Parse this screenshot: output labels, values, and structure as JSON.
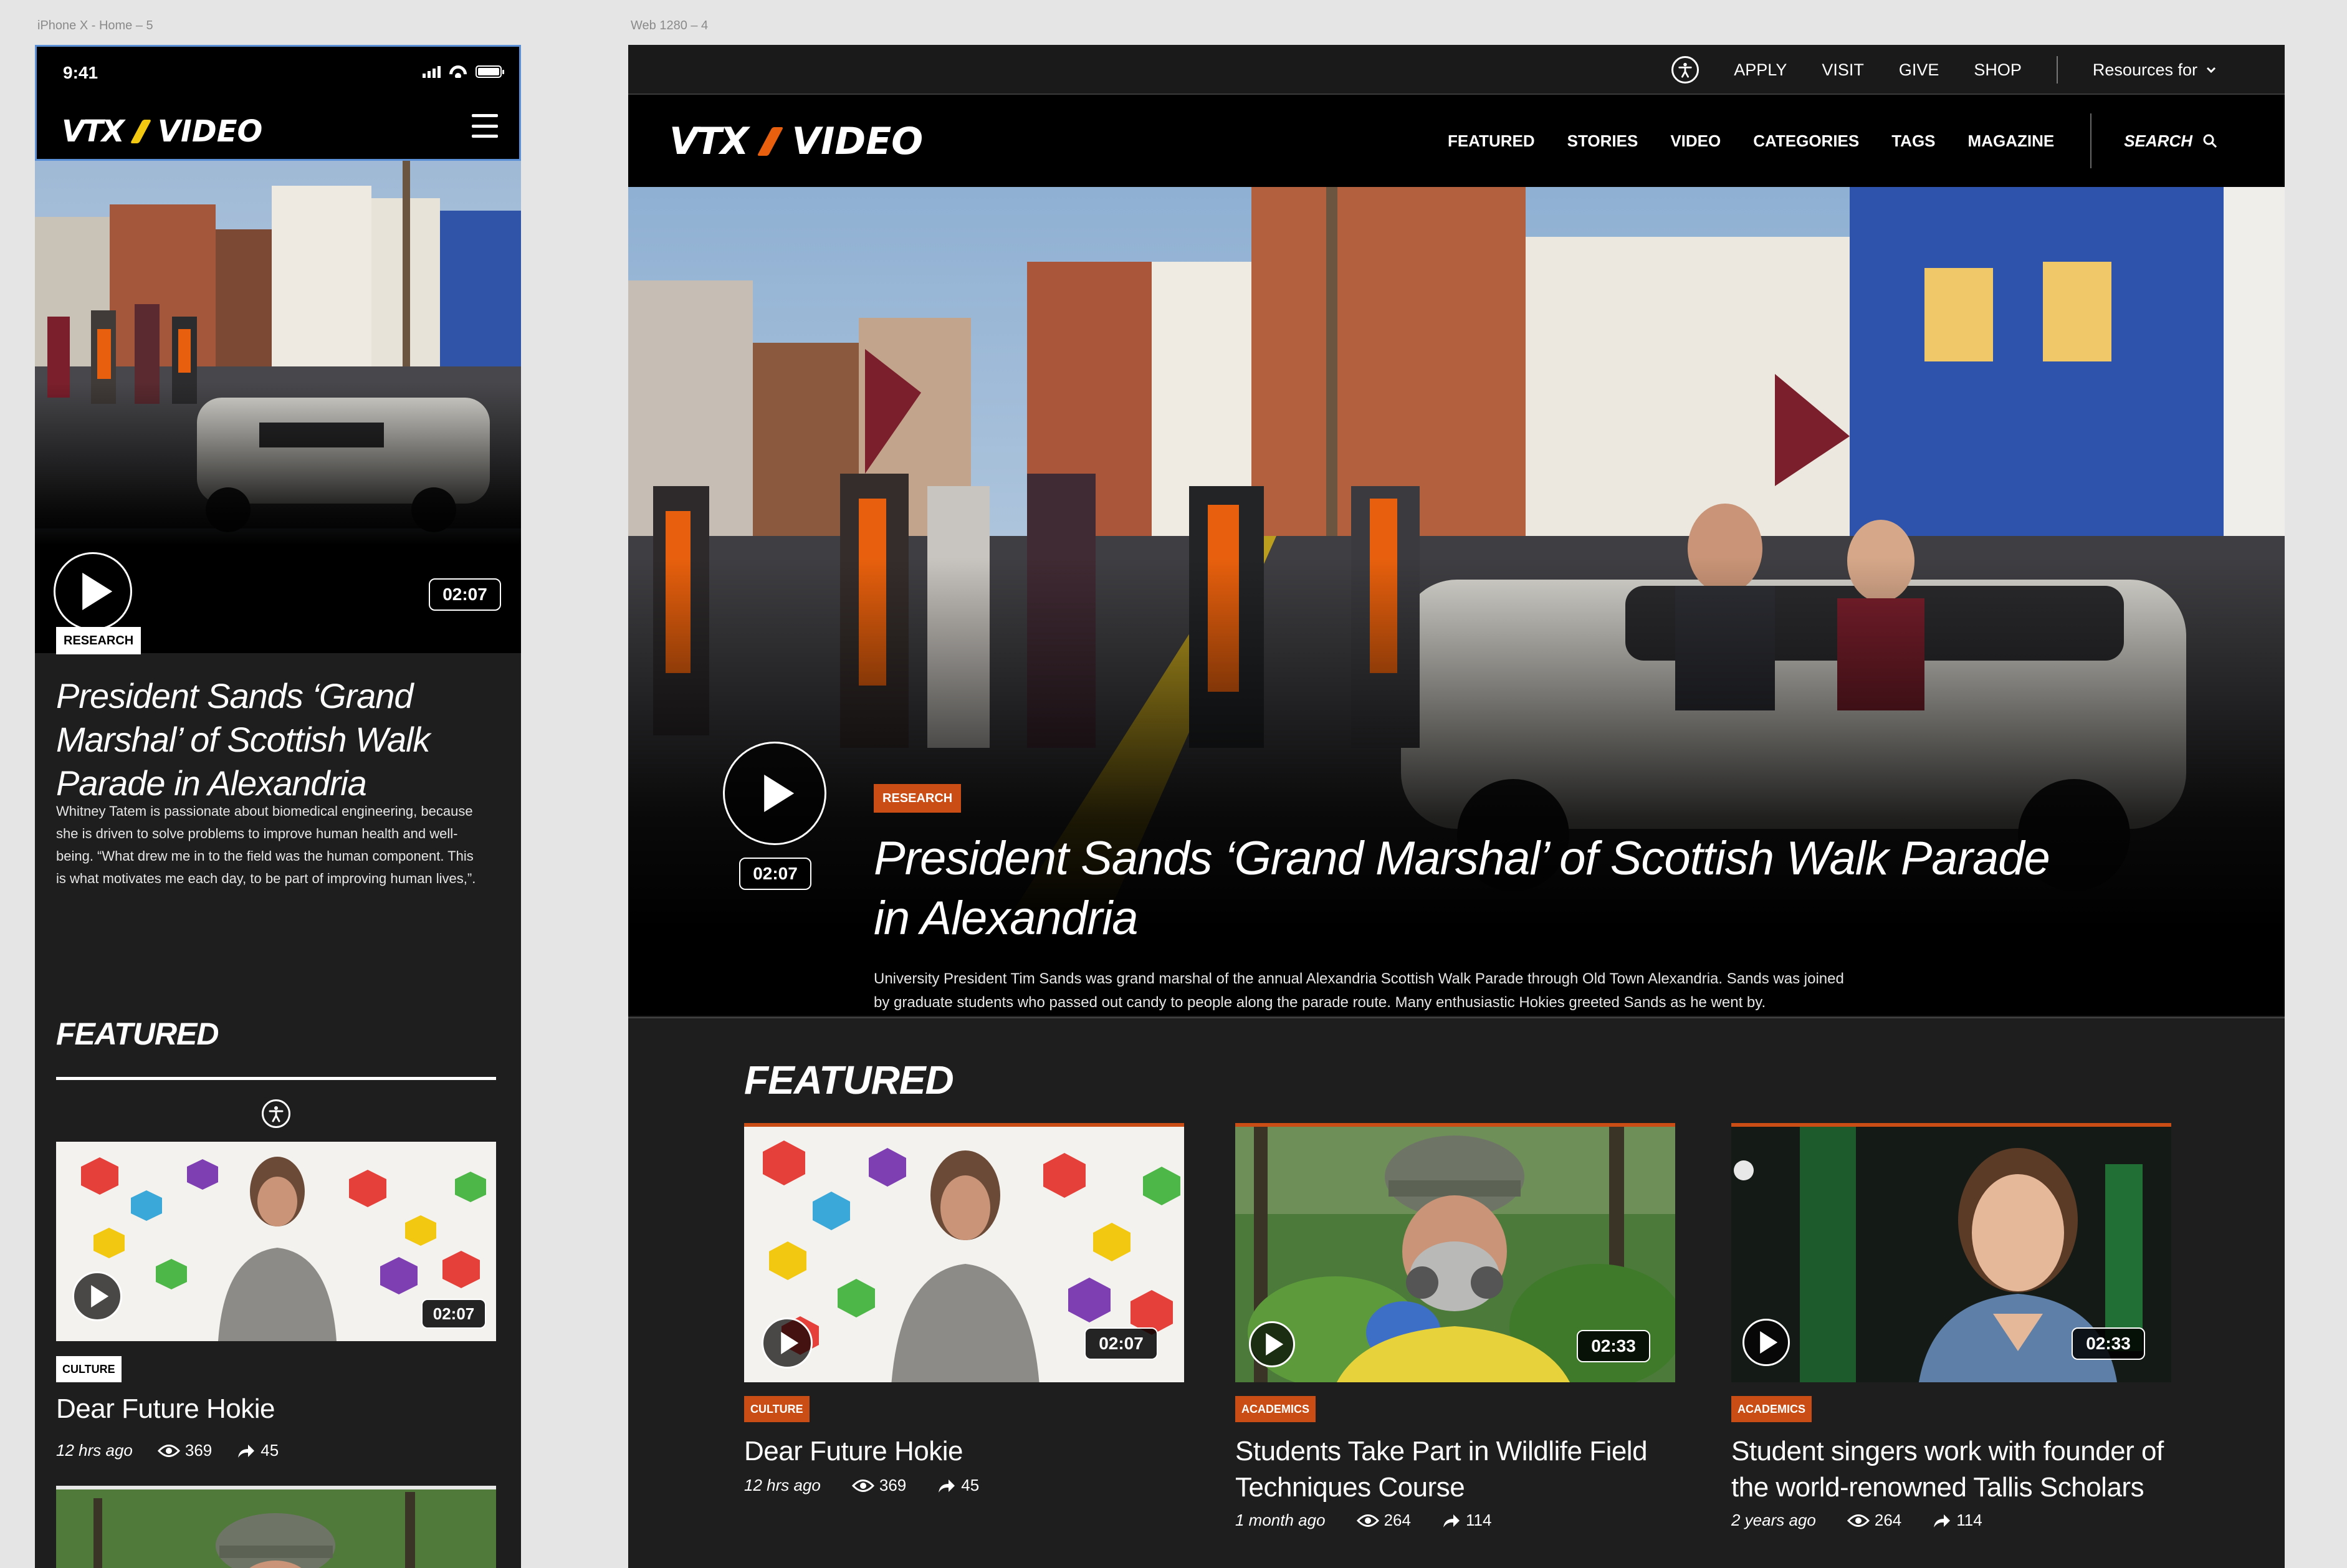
{
  "frames": {
    "mobile_label": "iPhone X - Home – 5",
    "desktop_label": "Web 1280 – 4"
  },
  "colors": {
    "accent": "#c94d14",
    "logo_slash": "#e8600d",
    "mobile_slash": "#f2c811",
    "bg_dark": "#1e1e1e"
  },
  "mobile": {
    "status": {
      "time": "9:41"
    },
    "logo": {
      "vt": "VTX",
      "word": "VIDEO"
    },
    "hero": {
      "duration": "02:07",
      "tag": "RESEARCH",
      "title_lines": [
        "President Sands ‘Grand",
        "Marshal’ of Scottish Walk",
        "Parade in Alexandria"
      ],
      "desc_lines": [
        "Whitney Tatem is passionate about biomedical engineering, because",
        "she is driven to solve problems to improve human health and well-",
        "being. “What drew me in to the field was the human component. This",
        "is what motivates me each day, to be part of improving human lives,”."
      ]
    },
    "featured": {
      "title": "FEATURED",
      "card": {
        "duration": "02:07",
        "tag": "CULTURE",
        "title": "Dear Future Hokie",
        "ago": "12 hrs ago",
        "views": "369",
        "shares": "45"
      }
    }
  },
  "desktop": {
    "util_nav": [
      "APPLY",
      "VISIT",
      "GIVE",
      "SHOP"
    ],
    "resources": "Resources for",
    "logo": {
      "vt": "VTX",
      "word": "VIDEO"
    },
    "main_nav": [
      "FEATURED",
      "STORIES",
      "VIDEO",
      "CATEGORIES",
      "TAGS",
      "MAGAZINE"
    ],
    "search": "SEARCH",
    "hero": {
      "tag": "RESEARCH",
      "duration": "02:07",
      "title_lines": [
        "President Sands ‘Grand Marshal’ of Scottish Walk Parade",
        "in Alexandria"
      ],
      "desc_lines": [
        "University President Tim Sands was grand marshal of the annual Alexandria Scottish Walk Parade through Old Town Alexandria. Sands was joined",
        "by graduate students who passed out candy to people along the parade route. Many enthusiastic Hokies greeted Sands as he went by."
      ]
    },
    "featured": {
      "title": "FEATURED",
      "cards": [
        {
          "duration": "02:07",
          "tag": "CULTURE",
          "title_lines": [
            "Dear Future Hokie"
          ],
          "ago": "12 hrs ago",
          "views": "369",
          "shares": "45"
        },
        {
          "duration": "02:33",
          "tag": "ACADEMICS",
          "title_lines": [
            "Students Take Part in Wildlife Field",
            "Techniques Course"
          ],
          "ago": "1 month ago",
          "views": "264",
          "shares": "114"
        },
        {
          "duration": "02:33",
          "tag": "ACADEMICS",
          "title_lines": [
            "Student singers work with founder of",
            "the world-renowned Tallis Scholars"
          ],
          "ago": "2 years ago",
          "views": "264",
          "shares": "114"
        }
      ]
    }
  }
}
